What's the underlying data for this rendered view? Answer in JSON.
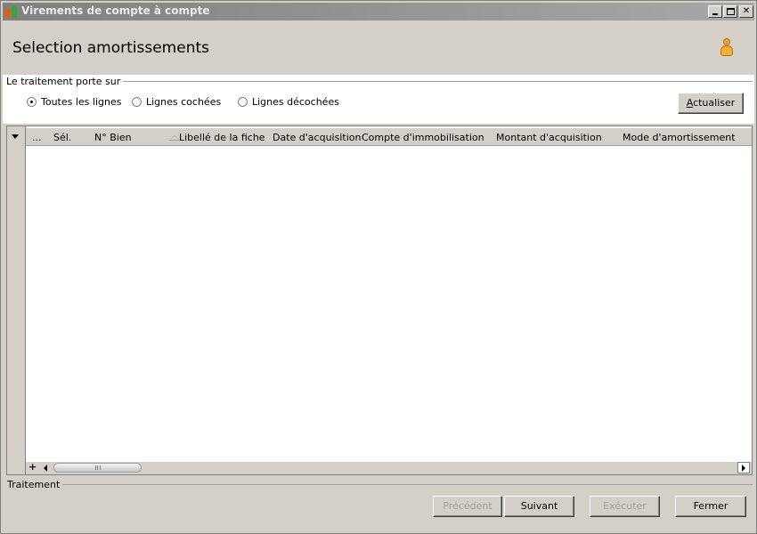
{
  "window": {
    "title": "Virements de compte à compte",
    "controls": [
      "minimize",
      "maximize",
      "close"
    ]
  },
  "header": {
    "title": "Selection amortissements",
    "icon": "user-icon"
  },
  "options": {
    "group_label": "Le traitement porte sur",
    "radios": [
      {
        "label": "Toutes les lignes",
        "selected": true
      },
      {
        "label": "Lignes cochées",
        "selected": false
      },
      {
        "label": "Lignes décochées",
        "selected": false
      }
    ],
    "refresh_button": {
      "mnemonic": "A",
      "rest": "ctualiser"
    }
  },
  "grid": {
    "columns": [
      "...",
      "Sél.",
      "N° Bien",
      "Libellé de  la fiche",
      "Date d'acquisition",
      "Compte d'immobilisation",
      "Montant d'acquisition",
      "Mode d'amortissement"
    ],
    "rows": [],
    "add_label": "+"
  },
  "footer": {
    "group_label": "Traitement",
    "buttons": {
      "previous": "Précédent",
      "next": "Suivant",
      "execute": "Exécuter",
      "close": "Fermer"
    }
  },
  "colors": {
    "window_bg": "#d4d0c8",
    "title_bar": "#808080",
    "panel_bg": "#ffffff",
    "disabled_text": "#a0a0a0"
  }
}
